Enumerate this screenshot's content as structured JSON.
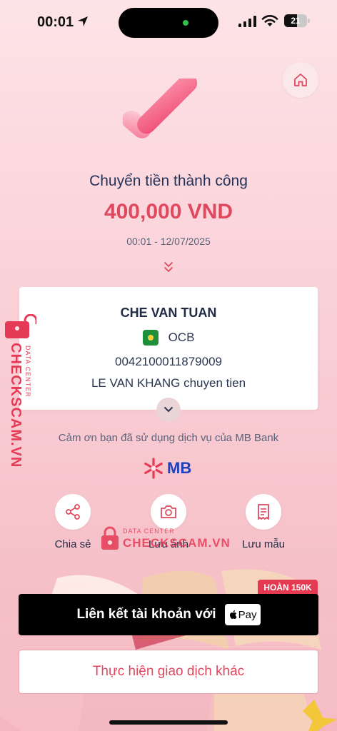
{
  "status_bar": {
    "time": "00:01",
    "battery": "21"
  },
  "result": {
    "title": "Chuyển tiền thành công",
    "amount": "400,000 VND",
    "datetime": "00:01 - 12/07/2025"
  },
  "recipient": {
    "name": "CHE VAN TUAN",
    "bank": "OCB",
    "account": "0042100011879009",
    "memo": "LE VAN KHANG chuyen tien"
  },
  "thanks": "Cảm ơn bạn đã sử dụng dịch vụ của MB Bank",
  "brand": {
    "logo_text": "MB",
    "color": "#1d3fbf",
    "accent": "#e43b52"
  },
  "actions": [
    {
      "label": "Chia sẻ",
      "icon": "share-icon"
    },
    {
      "label": "Lưu ảnh",
      "icon": "camera-icon"
    },
    {
      "label": "Lưu mẫu",
      "icon": "receipt-icon"
    }
  ],
  "watermark": {
    "sub": "DATA CENTER",
    "text": "CHECKSCAM.VN"
  },
  "applepay": {
    "badge": "HOÀN 150K",
    "label": "Liên kết tài khoản với",
    "pay_text": "Pay"
  },
  "other_transaction": {
    "label": "Thực hiện giao dịch khác"
  }
}
